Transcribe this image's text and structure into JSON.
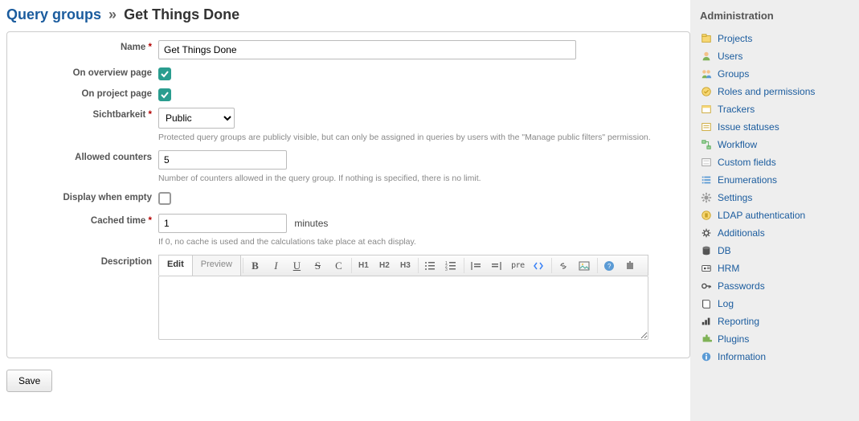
{
  "breadcrumb": {
    "root": "Query groups",
    "sep": "»",
    "current": "Get Things Done"
  },
  "form": {
    "name": {
      "label": "Name",
      "value": "Get Things Done"
    },
    "on_overview": {
      "label": "On overview page",
      "checked": true
    },
    "on_project": {
      "label": "On project page",
      "checked": true
    },
    "visibility": {
      "label": "Sichtbarkeit",
      "value": "Public",
      "hint": "Protected query groups are publicly visible, but can only be assigned in queries by users with the \"Manage public filters\" permission."
    },
    "allowed_counters": {
      "label": "Allowed counters",
      "value": "5",
      "hint": "Number of counters allowed in the query group. If nothing is specified, there is no limit."
    },
    "display_empty": {
      "label": "Display when empty",
      "checked": false
    },
    "cached_time": {
      "label": "Cached time",
      "value": "1",
      "unit": "minutes",
      "hint": "If 0, no cache is used and the calculations take place at each display."
    },
    "description": {
      "label": "Description"
    },
    "editor": {
      "tab_edit": "Edit",
      "tab_preview": "Preview",
      "btn_bold": "B",
      "btn_italic": "I",
      "btn_underline": "U",
      "btn_strike": "S",
      "btn_code": "C",
      "btn_h1": "H1",
      "btn_h2": "H2",
      "btn_h3": "H3",
      "btn_pre": "pre"
    },
    "save": "Save"
  },
  "sidebar": {
    "title": "Administration",
    "items": [
      {
        "label": "Projects",
        "icon": "projects"
      },
      {
        "label": "Users",
        "icon": "user"
      },
      {
        "label": "Groups",
        "icon": "group"
      },
      {
        "label": "Roles and permissions",
        "icon": "roles"
      },
      {
        "label": "Trackers",
        "icon": "trackers"
      },
      {
        "label": "Issue statuses",
        "icon": "statuses"
      },
      {
        "label": "Workflow",
        "icon": "workflow"
      },
      {
        "label": "Custom fields",
        "icon": "fields"
      },
      {
        "label": "Enumerations",
        "icon": "list"
      },
      {
        "label": "Settings",
        "icon": "gear"
      },
      {
        "label": "LDAP authentication",
        "icon": "ldap"
      },
      {
        "label": "Additionals",
        "icon": "cog"
      },
      {
        "label": "DB",
        "icon": "db"
      },
      {
        "label": "HRM",
        "icon": "id"
      },
      {
        "label": "Passwords",
        "icon": "key"
      },
      {
        "label": "Log",
        "icon": "book"
      },
      {
        "label": "Reporting",
        "icon": "chart"
      },
      {
        "label": "Plugins",
        "icon": "puzzle"
      },
      {
        "label": "Information",
        "icon": "info"
      }
    ]
  }
}
